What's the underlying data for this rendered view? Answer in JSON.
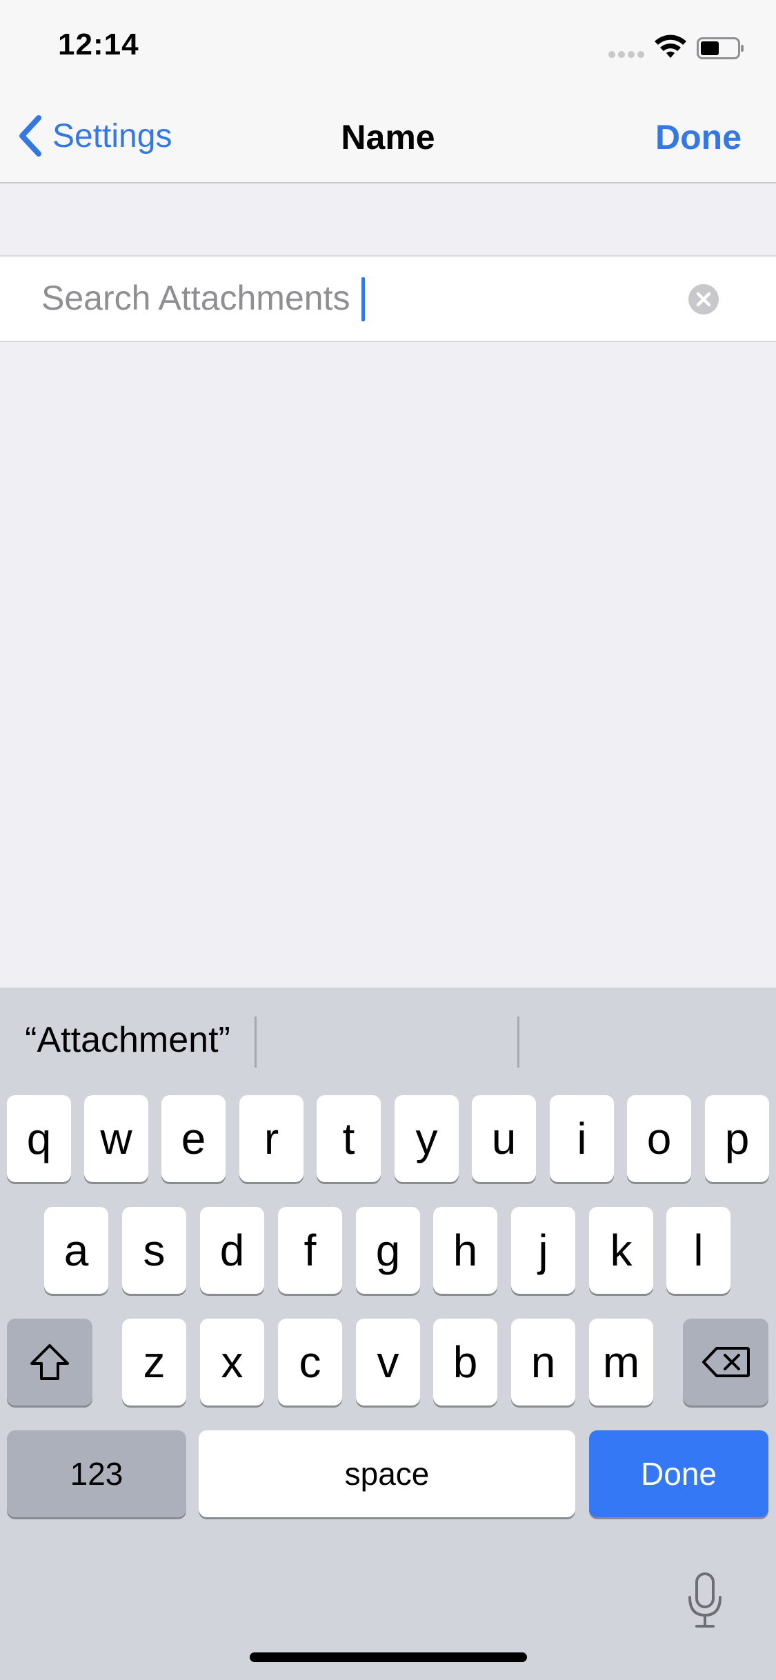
{
  "status_bar": {
    "time": "12:14"
  },
  "nav": {
    "back_label": "Settings",
    "title": "Name",
    "done_label": "Done"
  },
  "search": {
    "placeholder": "Search Attachments",
    "value": ""
  },
  "keyboard": {
    "predictions": [
      "“Attachment”",
      "",
      ""
    ],
    "row1": [
      "q",
      "w",
      "e",
      "r",
      "t",
      "y",
      "u",
      "i",
      "o",
      "p"
    ],
    "row2": [
      "a",
      "s",
      "d",
      "f",
      "g",
      "h",
      "j",
      "k",
      "l"
    ],
    "row3": [
      "z",
      "x",
      "c",
      "v",
      "b",
      "n",
      "m"
    ],
    "numbers_label": "123",
    "space_label": "space",
    "done_label": "Done"
  },
  "colors": {
    "accent": "#3478e6",
    "keyboard_bg": "#d1d4db",
    "function_key": "#acb0bb",
    "done_key": "#3478f6"
  },
  "icons": {
    "back": "chevron-left-icon",
    "clear": "clear-circle-icon",
    "shift": "shift-arrow-icon",
    "delete": "backspace-icon",
    "dictation": "microphone-icon",
    "wifi": "wifi-icon",
    "battery": "battery-icon",
    "signal": "signal-dots-icon"
  }
}
